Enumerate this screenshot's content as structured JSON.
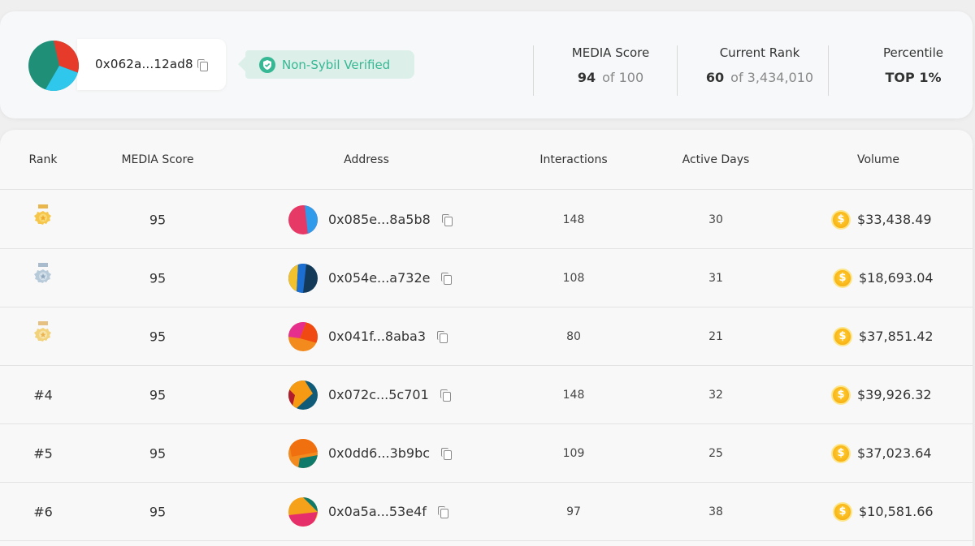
{
  "profile": {
    "address": "0x062a...12ad8",
    "verified_label": "Non-Sybil Verified"
  },
  "stats": {
    "media_score": {
      "label": "MEDIA Score",
      "value": "94",
      "suffix": "of 100"
    },
    "current_rank": {
      "label": "Current Rank",
      "value": "60",
      "suffix": "of 3,434,010"
    },
    "percentile": {
      "label": "Percentile",
      "value": "TOP 1%"
    }
  },
  "table": {
    "headers": {
      "rank": "Rank",
      "score": "MEDIA Score",
      "address": "Address",
      "interactions": "Interactions",
      "active_days": "Active Days",
      "volume": "Volume"
    },
    "rows": [
      {
        "rank": "",
        "medal": "gold-medal-icon",
        "score": "95",
        "address": "0x085e...8a5b8",
        "interactions": "148",
        "active_days": "30",
        "volume": "$33,438.49"
      },
      {
        "rank": "",
        "medal": "silver-medal-icon",
        "score": "95",
        "address": "0x054e...a732e",
        "interactions": "108",
        "active_days": "31",
        "volume": "$18,693.04"
      },
      {
        "rank": "",
        "medal": "bronze-medal-icon",
        "score": "95",
        "address": "0x041f...8aba3",
        "interactions": "80",
        "active_days": "21",
        "volume": "$37,851.42"
      },
      {
        "rank": "#4",
        "medal": "",
        "score": "95",
        "address": "0x072c...5c701",
        "interactions": "148",
        "active_days": "32",
        "volume": "$39,926.32"
      },
      {
        "rank": "#5",
        "medal": "",
        "score": "95",
        "address": "0x0dd6...3b9bc",
        "interactions": "109",
        "active_days": "25",
        "volume": "$37,023.64"
      },
      {
        "rank": "#6",
        "medal": "",
        "score": "95",
        "address": "0x0a5a...53e4f",
        "interactions": "97",
        "active_days": "38",
        "volume": "$10,581.66"
      }
    ]
  },
  "colors": {
    "verified_green": "#35b893",
    "verified_bg": "#dcefe9",
    "coin_gold": "#f9b81a"
  }
}
